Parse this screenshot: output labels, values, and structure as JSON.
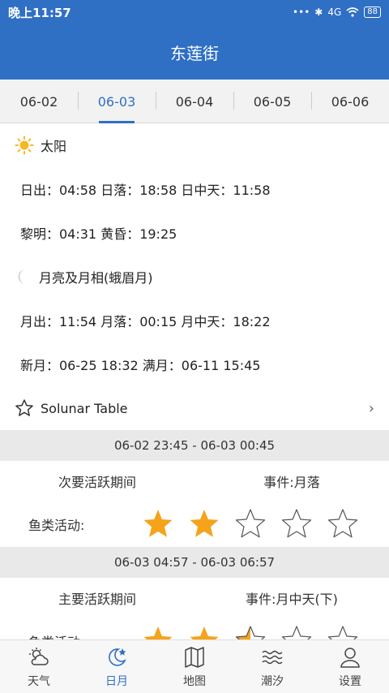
{
  "status_bar": {
    "time": "晚上11:57",
    "network": "4G",
    "battery": "88"
  },
  "app_bar": {
    "title": "东莲街"
  },
  "date_tabs": [
    {
      "label": "06-02",
      "active": false
    },
    {
      "label": "06-03",
      "active": true
    },
    {
      "label": "06-04",
      "active": false
    },
    {
      "label": "06-05",
      "active": false
    },
    {
      "label": "06-06",
      "active": false
    }
  ],
  "sun": {
    "section_title": "太阳",
    "rise_set": "日出：04:58 日落：18:58  日中天：11:58",
    "dawn_dusk": "黎明：04:31 黄昏：19:25"
  },
  "moon": {
    "section_title": "月亮及月相(蛾眉月)",
    "rise_set": "月出：11:54 月落：00:15 月中天：18:22",
    "phases": "新月：06-25 18:32 满月：06-11 15:45"
  },
  "solunar": {
    "title": "Solunar Table",
    "activity_label": "鱼类活动:",
    "periods": [
      {
        "time_range": "06-02 23:45 - 06-03 00:45",
        "type": "次要活跃期间",
        "event": "事件:月落",
        "rating": 2
      },
      {
        "time_range": "06-03 04:57 - 06-03 06:57",
        "type": "主要活跃期间",
        "event": "事件:月中天(下)",
        "rating": 2.5
      }
    ]
  },
  "bottom_nav": [
    {
      "label": "天气",
      "icon": "weather-icon",
      "active": false
    },
    {
      "label": "日月",
      "icon": "moon-star-icon",
      "active": true
    },
    {
      "label": "地图",
      "icon": "map-icon",
      "active": false
    },
    {
      "label": "潮汐",
      "icon": "waves-icon",
      "active": false
    },
    {
      "label": "设置",
      "icon": "person-icon",
      "active": false
    }
  ],
  "colors": {
    "primary": "#2f6fc4",
    "star_fill": "#f5a31a",
    "sun": "#f5b820"
  }
}
